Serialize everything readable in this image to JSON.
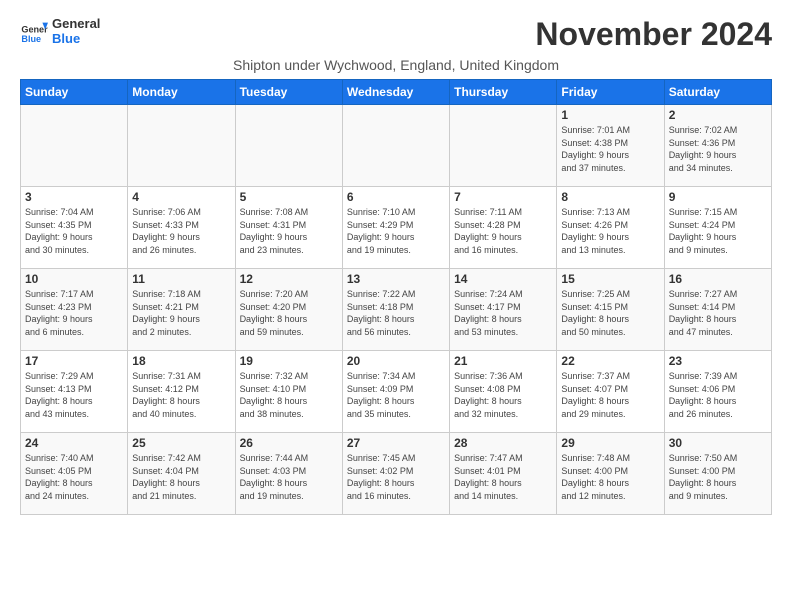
{
  "header": {
    "logo_line1": "General",
    "logo_line2": "Blue",
    "month_title": "November 2024",
    "subtitle": "Shipton under Wychwood, England, United Kingdom"
  },
  "weekdays": [
    "Sunday",
    "Monday",
    "Tuesday",
    "Wednesday",
    "Thursday",
    "Friday",
    "Saturday"
  ],
  "weeks": [
    [
      {
        "day": "",
        "info": ""
      },
      {
        "day": "",
        "info": ""
      },
      {
        "day": "",
        "info": ""
      },
      {
        "day": "",
        "info": ""
      },
      {
        "day": "",
        "info": ""
      },
      {
        "day": "1",
        "info": "Sunrise: 7:01 AM\nSunset: 4:38 PM\nDaylight: 9 hours\nand 37 minutes."
      },
      {
        "day": "2",
        "info": "Sunrise: 7:02 AM\nSunset: 4:36 PM\nDaylight: 9 hours\nand 34 minutes."
      }
    ],
    [
      {
        "day": "3",
        "info": "Sunrise: 7:04 AM\nSunset: 4:35 PM\nDaylight: 9 hours\nand 30 minutes."
      },
      {
        "day": "4",
        "info": "Sunrise: 7:06 AM\nSunset: 4:33 PM\nDaylight: 9 hours\nand 26 minutes."
      },
      {
        "day": "5",
        "info": "Sunrise: 7:08 AM\nSunset: 4:31 PM\nDaylight: 9 hours\nand 23 minutes."
      },
      {
        "day": "6",
        "info": "Sunrise: 7:10 AM\nSunset: 4:29 PM\nDaylight: 9 hours\nand 19 minutes."
      },
      {
        "day": "7",
        "info": "Sunrise: 7:11 AM\nSunset: 4:28 PM\nDaylight: 9 hours\nand 16 minutes."
      },
      {
        "day": "8",
        "info": "Sunrise: 7:13 AM\nSunset: 4:26 PM\nDaylight: 9 hours\nand 13 minutes."
      },
      {
        "day": "9",
        "info": "Sunrise: 7:15 AM\nSunset: 4:24 PM\nDaylight: 9 hours\nand 9 minutes."
      }
    ],
    [
      {
        "day": "10",
        "info": "Sunrise: 7:17 AM\nSunset: 4:23 PM\nDaylight: 9 hours\nand 6 minutes."
      },
      {
        "day": "11",
        "info": "Sunrise: 7:18 AM\nSunset: 4:21 PM\nDaylight: 9 hours\nand 2 minutes."
      },
      {
        "day": "12",
        "info": "Sunrise: 7:20 AM\nSunset: 4:20 PM\nDaylight: 8 hours\nand 59 minutes."
      },
      {
        "day": "13",
        "info": "Sunrise: 7:22 AM\nSunset: 4:18 PM\nDaylight: 8 hours\nand 56 minutes."
      },
      {
        "day": "14",
        "info": "Sunrise: 7:24 AM\nSunset: 4:17 PM\nDaylight: 8 hours\nand 53 minutes."
      },
      {
        "day": "15",
        "info": "Sunrise: 7:25 AM\nSunset: 4:15 PM\nDaylight: 8 hours\nand 50 minutes."
      },
      {
        "day": "16",
        "info": "Sunrise: 7:27 AM\nSunset: 4:14 PM\nDaylight: 8 hours\nand 47 minutes."
      }
    ],
    [
      {
        "day": "17",
        "info": "Sunrise: 7:29 AM\nSunset: 4:13 PM\nDaylight: 8 hours\nand 43 minutes."
      },
      {
        "day": "18",
        "info": "Sunrise: 7:31 AM\nSunset: 4:12 PM\nDaylight: 8 hours\nand 40 minutes."
      },
      {
        "day": "19",
        "info": "Sunrise: 7:32 AM\nSunset: 4:10 PM\nDaylight: 8 hours\nand 38 minutes."
      },
      {
        "day": "20",
        "info": "Sunrise: 7:34 AM\nSunset: 4:09 PM\nDaylight: 8 hours\nand 35 minutes."
      },
      {
        "day": "21",
        "info": "Sunrise: 7:36 AM\nSunset: 4:08 PM\nDaylight: 8 hours\nand 32 minutes."
      },
      {
        "day": "22",
        "info": "Sunrise: 7:37 AM\nSunset: 4:07 PM\nDaylight: 8 hours\nand 29 minutes."
      },
      {
        "day": "23",
        "info": "Sunrise: 7:39 AM\nSunset: 4:06 PM\nDaylight: 8 hours\nand 26 minutes."
      }
    ],
    [
      {
        "day": "24",
        "info": "Sunrise: 7:40 AM\nSunset: 4:05 PM\nDaylight: 8 hours\nand 24 minutes."
      },
      {
        "day": "25",
        "info": "Sunrise: 7:42 AM\nSunset: 4:04 PM\nDaylight: 8 hours\nand 21 minutes."
      },
      {
        "day": "26",
        "info": "Sunrise: 7:44 AM\nSunset: 4:03 PM\nDaylight: 8 hours\nand 19 minutes."
      },
      {
        "day": "27",
        "info": "Sunrise: 7:45 AM\nSunset: 4:02 PM\nDaylight: 8 hours\nand 16 minutes."
      },
      {
        "day": "28",
        "info": "Sunrise: 7:47 AM\nSunset: 4:01 PM\nDaylight: 8 hours\nand 14 minutes."
      },
      {
        "day": "29",
        "info": "Sunrise: 7:48 AM\nSunset: 4:00 PM\nDaylight: 8 hours\nand 12 minutes."
      },
      {
        "day": "30",
        "info": "Sunrise: 7:50 AM\nSunset: 4:00 PM\nDaylight: 8 hours\nand 9 minutes."
      }
    ]
  ]
}
